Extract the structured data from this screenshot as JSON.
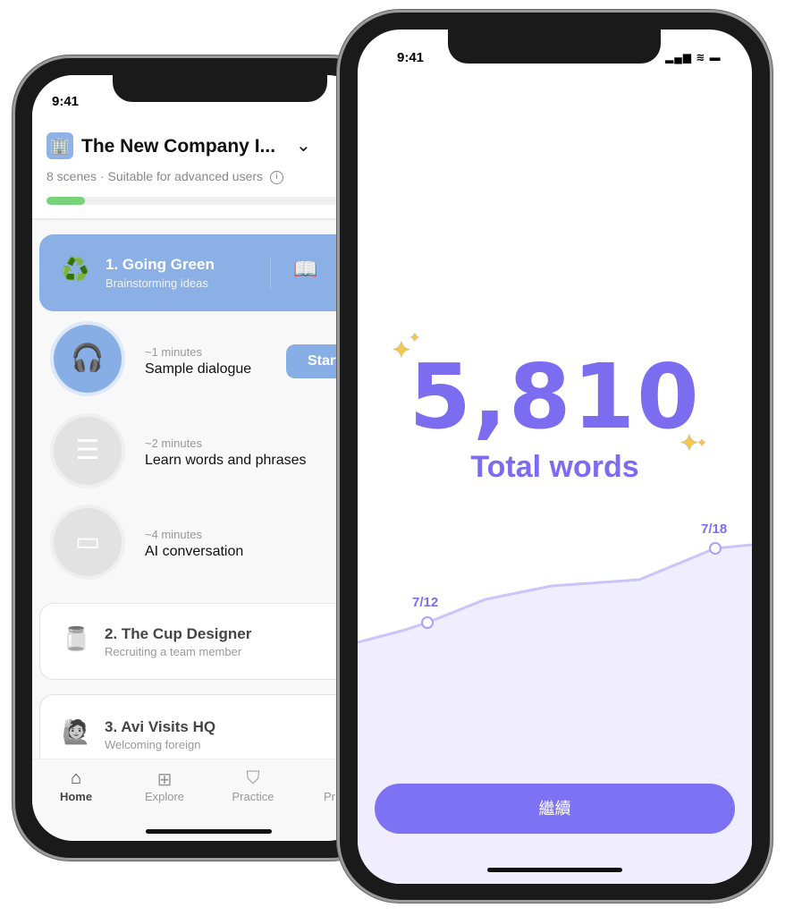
{
  "left_phone": {
    "status_time": "9:41",
    "course": {
      "title": "The New Company I...",
      "meta": "8 scenes · Suitable for advanced users",
      "progress_percent": 12
    },
    "active_scene": {
      "title": "1. Going Green",
      "subtitle": "Brainstorming ideas"
    },
    "steps": [
      {
        "duration": "~1 minutes",
        "name": "Sample dialogue",
        "icon": "headphones-icon",
        "button": "Start"
      },
      {
        "duration": "~2 minutes",
        "name": "Learn words and phrases",
        "icon": "list-icon"
      },
      {
        "duration": "~4 minutes",
        "name": "AI conversation",
        "icon": "chat-icon"
      }
    ],
    "scenes": [
      {
        "title": "2. The Cup Designer",
        "subtitle": "Recruiting a team member"
      },
      {
        "title": "3. Avi Visits HQ",
        "subtitle": "Welcoming foreign"
      }
    ],
    "tabs": [
      {
        "label": "Home",
        "active": true
      },
      {
        "label": "Explore"
      },
      {
        "label": "Practice"
      },
      {
        "label": "Pr"
      }
    ]
  },
  "right_phone": {
    "status_time": "9:41",
    "total": "5,810",
    "total_label": "Total words",
    "chart_labels": [
      "7/12",
      "7/18"
    ],
    "continue_button": "繼續",
    "accent": "#7b6cf0"
  }
}
